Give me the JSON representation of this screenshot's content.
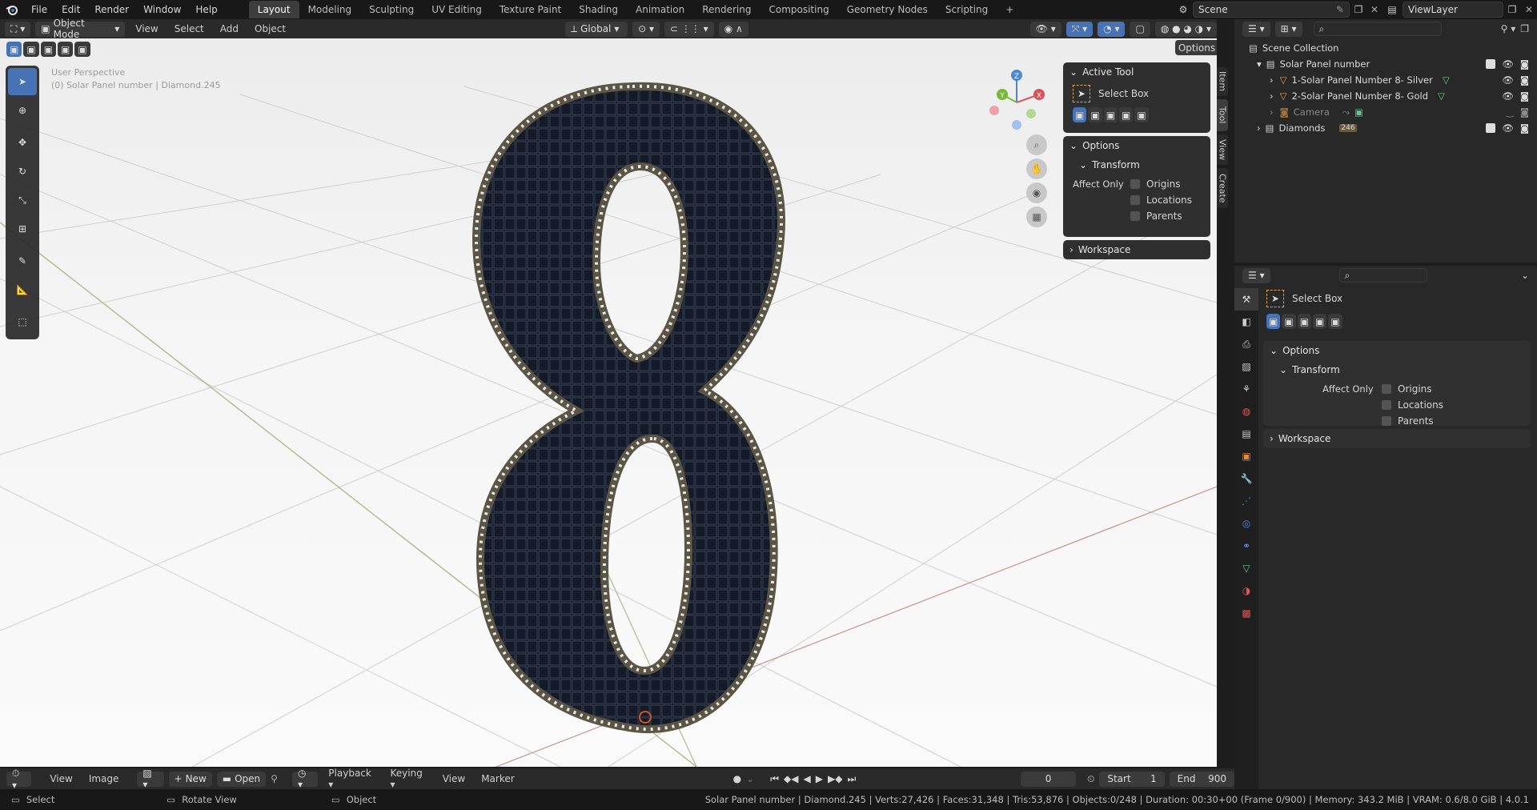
{
  "topbar": {
    "menus": [
      "File",
      "Edit",
      "Render",
      "Window",
      "Help"
    ],
    "workspaces": [
      "Layout",
      "Modeling",
      "Sculpting",
      "UV Editing",
      "Texture Paint",
      "Shading",
      "Animation",
      "Rendering",
      "Compositing",
      "Geometry Nodes",
      "Scripting"
    ],
    "active_workspace": "Layout",
    "add_tab": "+",
    "scene": "Scene",
    "view_layer": "ViewLayer"
  },
  "viewport_header": {
    "mode": "Object Mode",
    "menus": [
      "View",
      "Select",
      "Add",
      "Object"
    ],
    "orientation": "Global",
    "options_label": "Options"
  },
  "viewport": {
    "perspective": "User Perspective",
    "active_object": "(0) Solar Panel number | Diamond.245",
    "gizmo_axes": {
      "x": "X",
      "y": "Y",
      "z": "Z"
    },
    "accent": "#4772b3"
  },
  "npanel": {
    "active_tool_title": "Active Tool",
    "tool_name": "Select Box",
    "options_title": "Options",
    "transform_title": "Transform",
    "affect_only": "Affect Only",
    "checks": [
      "Origins",
      "Locations",
      "Parents"
    ],
    "workspace_title": "Workspace",
    "side_tabs": [
      "Item",
      "Tool",
      "View",
      "Create"
    ]
  },
  "outliner": {
    "root": "Scene Collection",
    "collection": "Solar Panel number",
    "items": [
      "1-Solar Panel  Number 8- Silver",
      "2-Solar Panel  Number 8- Gold",
      "Camera"
    ],
    "collection2": "Diamonds",
    "diamond_count": "246"
  },
  "properties": {
    "tool_name": "Select Box",
    "options_title": "Options",
    "transform_title": "Transform",
    "affect_only": "Affect Only",
    "checks": [
      "Origins",
      "Locations",
      "Parents"
    ],
    "workspace_title": "Workspace"
  },
  "timeline": {
    "menus": [
      "View",
      "Image"
    ],
    "new_label": "New",
    "open_label": "Open",
    "menus2": [
      "Playback",
      "Keying",
      "View",
      "Marker"
    ],
    "frame": "0",
    "start_label": "Start",
    "start": "1",
    "end_label": "End",
    "end": "900"
  },
  "status": {
    "select": "Select",
    "rotate": "Rotate View",
    "object": "Object",
    "info": "Solar Panel number | Diamond.245 | Verts:27,426 | Faces:31,348 | Tris:53,876 | Objects:0/248 | Duration: 00:30+00 (Frame 0/900) | Memory: 343.2 MiB | VRAM: 0.6/8.0 GiB | 4.0.1"
  }
}
